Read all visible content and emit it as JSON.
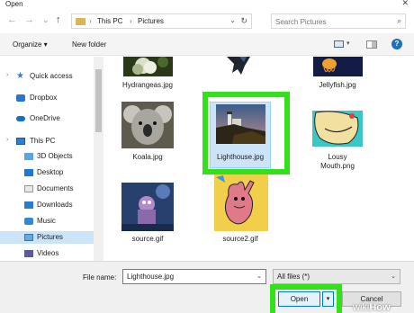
{
  "window": {
    "title": "Open",
    "close_glyph": "✕"
  },
  "nav": {
    "back_glyph": "←",
    "forward_glyph": "→",
    "recent_glyph": "⌄",
    "up_glyph": "↑",
    "breadcrumbs": [
      "This PC",
      "Pictures"
    ],
    "separator": "›",
    "refresh_glyph": "↻",
    "dropdown_glyph": "⌄"
  },
  "search": {
    "placeholder": "Search Pictures",
    "icon": "search-icon",
    "glyph": "⌕"
  },
  "toolbar": {
    "organize_label": "Organize ▾",
    "new_folder_label": "New folder",
    "help_label": "?",
    "view_dd_glyph": "▾"
  },
  "sidebar": {
    "items": [
      {
        "label": "Quick access",
        "icon": "star-icon"
      },
      {
        "label": "Dropbox",
        "icon": "dropbox-icon"
      },
      {
        "label": "OneDrive",
        "icon": "cloud-icon"
      },
      {
        "label": "This PC",
        "icon": "computer-icon"
      },
      {
        "label": "3D Objects",
        "icon": "cube-icon"
      },
      {
        "label": "Desktop",
        "icon": "desktop-icon"
      },
      {
        "label": "Documents",
        "icon": "documents-icon"
      },
      {
        "label": "Downloads",
        "icon": "downloads-icon"
      },
      {
        "label": "Music",
        "icon": "music-icon"
      },
      {
        "label": "Pictures",
        "icon": "pictures-icon"
      },
      {
        "label": "Videos",
        "icon": "videos-icon"
      }
    ],
    "expand_glyph": "›",
    "star_glyph": "★",
    "selected_item": "Pictures"
  },
  "files": [
    {
      "name": "Hydrangeas.jpg"
    },
    {
      "name": ""
    },
    {
      "name": "Jellyfish.jpg"
    },
    {
      "name": "Koala.jpg"
    },
    {
      "name": "Lighthouse.jpg"
    },
    {
      "name": "Lousy\nMouth.png"
    },
    {
      "name": "source.gif"
    },
    {
      "name": "source2.gif"
    }
  ],
  "selected_file": "Lighthouse.jpg",
  "bottom": {
    "file_name_label": "File name:",
    "file_name_value": "Lighthouse.jpg",
    "file_type_value": "All files (*)",
    "open_label": "Open",
    "cancel_label": "Cancel",
    "dropdown_glyph": "⌄",
    "split_glyph": "▾"
  },
  "watermark": {
    "wiki": "wiki",
    "how": "How"
  },
  "colors": {
    "highlight": "#33e11a",
    "selection": "#cce4f7",
    "accent": "#0078d7"
  }
}
